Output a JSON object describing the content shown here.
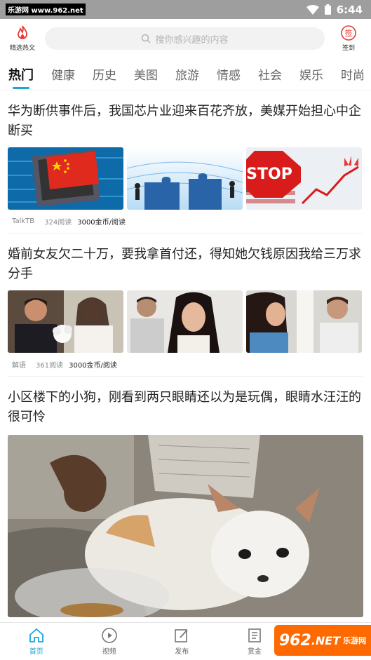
{
  "status_bar": {
    "watermark": "乐游网 www.962.net",
    "time": "6:44"
  },
  "header": {
    "left_label": "精选热文",
    "search_placeholder": "搜你感兴趣的内容",
    "right_label": "签到",
    "right_badge": "签"
  },
  "tabs": [
    "热门",
    "健康",
    "历史",
    "美图",
    "旅游",
    "情感",
    "社会",
    "娱乐",
    "时尚"
  ],
  "articles": [
    {
      "title": "华为断供事件后，我国芯片业迎来百花齐放，美媒开始担心中企断买",
      "source": "TalkTB",
      "reads": "324阅读",
      "reward": "3000金币/阅读"
    },
    {
      "title": "婚前女友欠二十万，要我拿首付还，得知她欠钱原因我给三万求分手",
      "source": "解语",
      "reads": "361阅读",
      "reward": "3000金币/阅读"
    },
    {
      "title": "小区楼下的小狗，刚看到两只眼睛还以为是玩偶，眼睛水汪汪的很可怜"
    }
  ],
  "bottom_nav": [
    "首页",
    "视频",
    "发布",
    "赏金"
  ],
  "brand_badge": {
    "text": "962",
    "suffix": ".NET",
    "sub": "乐游网"
  },
  "colors": {
    "accent": "#1aa5d6",
    "status_bar": "#9e9e9e",
    "brand_orange": "#ff6a00"
  }
}
